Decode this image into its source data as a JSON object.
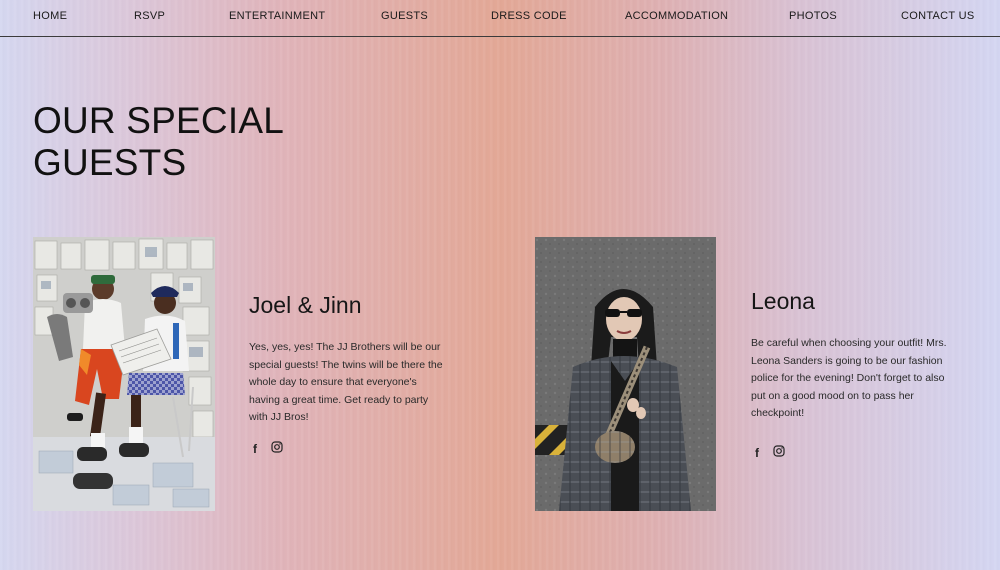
{
  "nav": {
    "items": [
      "HOME",
      "RSVP",
      "ENTERTAINMENT",
      "GUESTS",
      "DRESS CODE",
      "ACCOMMODATION",
      "PHOTOS",
      "CONTACT US"
    ]
  },
  "page_title": "OUR SPECIAL GUESTS",
  "guests": [
    {
      "name": "Joel & Jinn",
      "bio": "Yes, yes, yes! The JJ Brothers will be our special guests! The twins will be there the whole day to ensure that everyone's having a great time. Get ready to party with JJ Bros!",
      "social": [
        "facebook-icon",
        "instagram-icon"
      ],
      "photo": "two-men-reading-newspapers-photo"
    },
    {
      "name": "Leona",
      "bio": "Be careful when choosing your outfit! Mrs. Leona Sanders is going to be our fashion police for the evening! Don't forget to also put on a good mood on to pass her checkpoint!",
      "social": [
        "facebook-icon",
        "instagram-icon"
      ],
      "photo": "woman-in-plaid-coat-photo"
    }
  ],
  "colors": {
    "gradient_edge": "#d5d7f0",
    "gradient_center": "#e3a896",
    "text": "#151515"
  }
}
